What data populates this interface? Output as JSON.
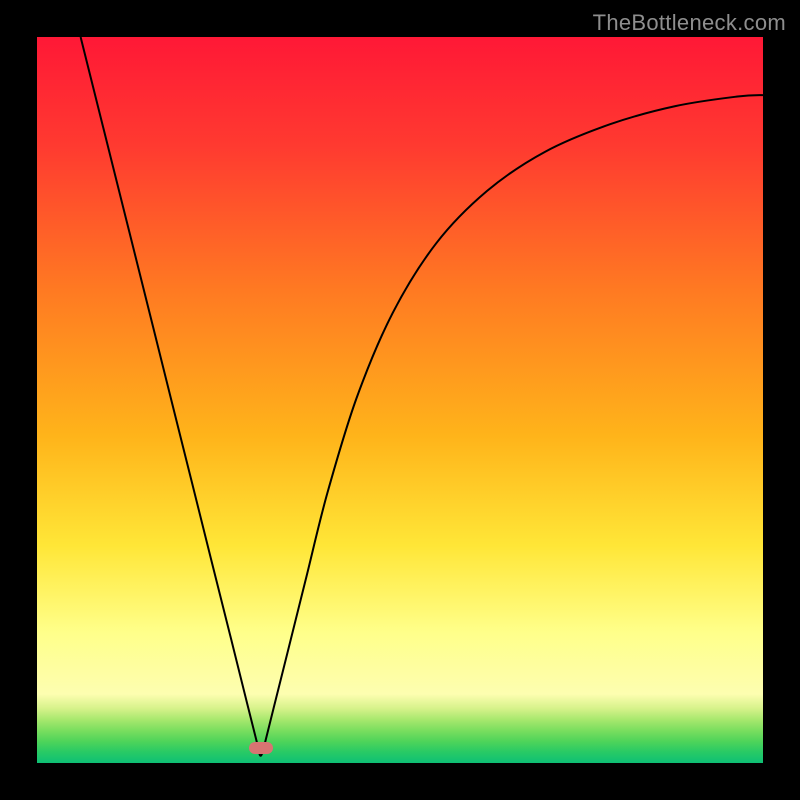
{
  "watermark": "TheBottleneck.com",
  "marker": {
    "x_frac": 0.308,
    "y_frac": 0.979
  },
  "chart_data": {
    "type": "line",
    "title": "",
    "xlabel": "",
    "ylabel": "",
    "xlim": [
      0,
      1
    ],
    "ylim": [
      0,
      1
    ],
    "series": [
      {
        "name": "curve",
        "x": [
          0.06,
          0.11,
          0.16,
          0.2,
          0.24,
          0.268,
          0.29,
          0.303,
          0.308,
          0.314,
          0.326,
          0.345,
          0.37,
          0.4,
          0.44,
          0.49,
          0.55,
          0.62,
          0.7,
          0.79,
          0.88,
          0.965,
          1.0
        ],
        "y": [
          1.0,
          0.8,
          0.6,
          0.44,
          0.28,
          0.168,
          0.08,
          0.028,
          0.01,
          0.028,
          0.076,
          0.152,
          0.252,
          0.372,
          0.502,
          0.62,
          0.716,
          0.788,
          0.842,
          0.88,
          0.905,
          0.918,
          0.92
        ],
        "note": "y is 'bottleneck' fraction; visually the plot renders 1-y from top so the minimum at x≈0.308 touches the bottom (green) band."
      }
    ],
    "background_gradient": {
      "direction": "vertical",
      "stops": [
        {
          "pos": 0.0,
          "color": "#ff1836"
        },
        {
          "pos": 0.35,
          "color": "#ff7a22"
        },
        {
          "pos": 0.7,
          "color": "#ffe637"
        },
        {
          "pos": 0.9,
          "color": "#fdfeb0"
        },
        {
          "pos": 1.0,
          "color": "#0ec075"
        }
      ]
    },
    "marker": {
      "x": 0.308,
      "y": 0.01,
      "color": "#d87472"
    }
  }
}
